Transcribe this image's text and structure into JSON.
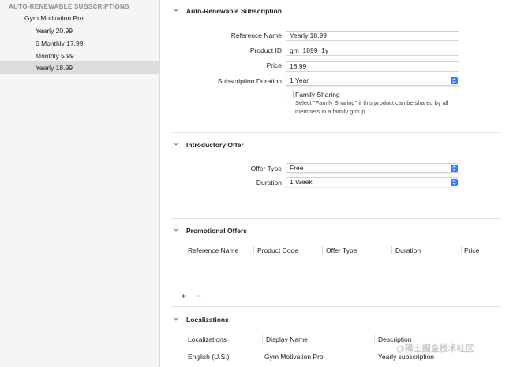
{
  "sidebar": {
    "header": "AUTO-RENEWABLE SUBSCRIPTIONS",
    "group": "Gym Motivation Pro",
    "items": [
      {
        "label": "Yearly 20.99",
        "selected": false
      },
      {
        "label": "6 Monthly 17.99",
        "selected": false
      },
      {
        "label": "Monthly 5.99",
        "selected": false
      },
      {
        "label": "Yearly 18.99",
        "selected": true
      }
    ]
  },
  "subscription": {
    "title": "Auto-Renewable Subscription",
    "reference_name_label": "Reference Name",
    "reference_name_value": "Yearly 18.99",
    "product_id_label": "Product ID",
    "product_id_value": "gm_1899_1y",
    "price_label": "Price",
    "price_value": "18.99",
    "duration_label": "Subscription Duration",
    "duration_value": "1 Year",
    "family_sharing_label": "Family Sharing",
    "family_sharing_checked": false,
    "family_sharing_help": "Select \"Family Sharing\" if this product can be shared by all members in a family group."
  },
  "intro_offer": {
    "title": "Introductory Offer",
    "offer_type_label": "Offer Type",
    "offer_type_value": "Free",
    "duration_label": "Duration",
    "duration_value": "1 Week"
  },
  "promo": {
    "title": "Promotional Offers",
    "columns": [
      "Reference Name",
      "Product Code",
      "Offer Type",
      "Duration",
      "Price"
    ],
    "add_label": "+",
    "remove_label": "−"
  },
  "localizations": {
    "title": "Localizations",
    "columns": [
      "Localizations",
      "Display Name",
      "Description"
    ],
    "rows": [
      {
        "locale": "English (U.S.)",
        "display_name": "Gym Motivation Pro",
        "description": "Yearly subscription"
      }
    ]
  },
  "watermark": "@稀土掘金技术社区",
  "colors": {
    "accent": "#2f7cf6",
    "sidebar_bg": "#f5f5f5",
    "selected_bg": "#dcdcdc"
  }
}
